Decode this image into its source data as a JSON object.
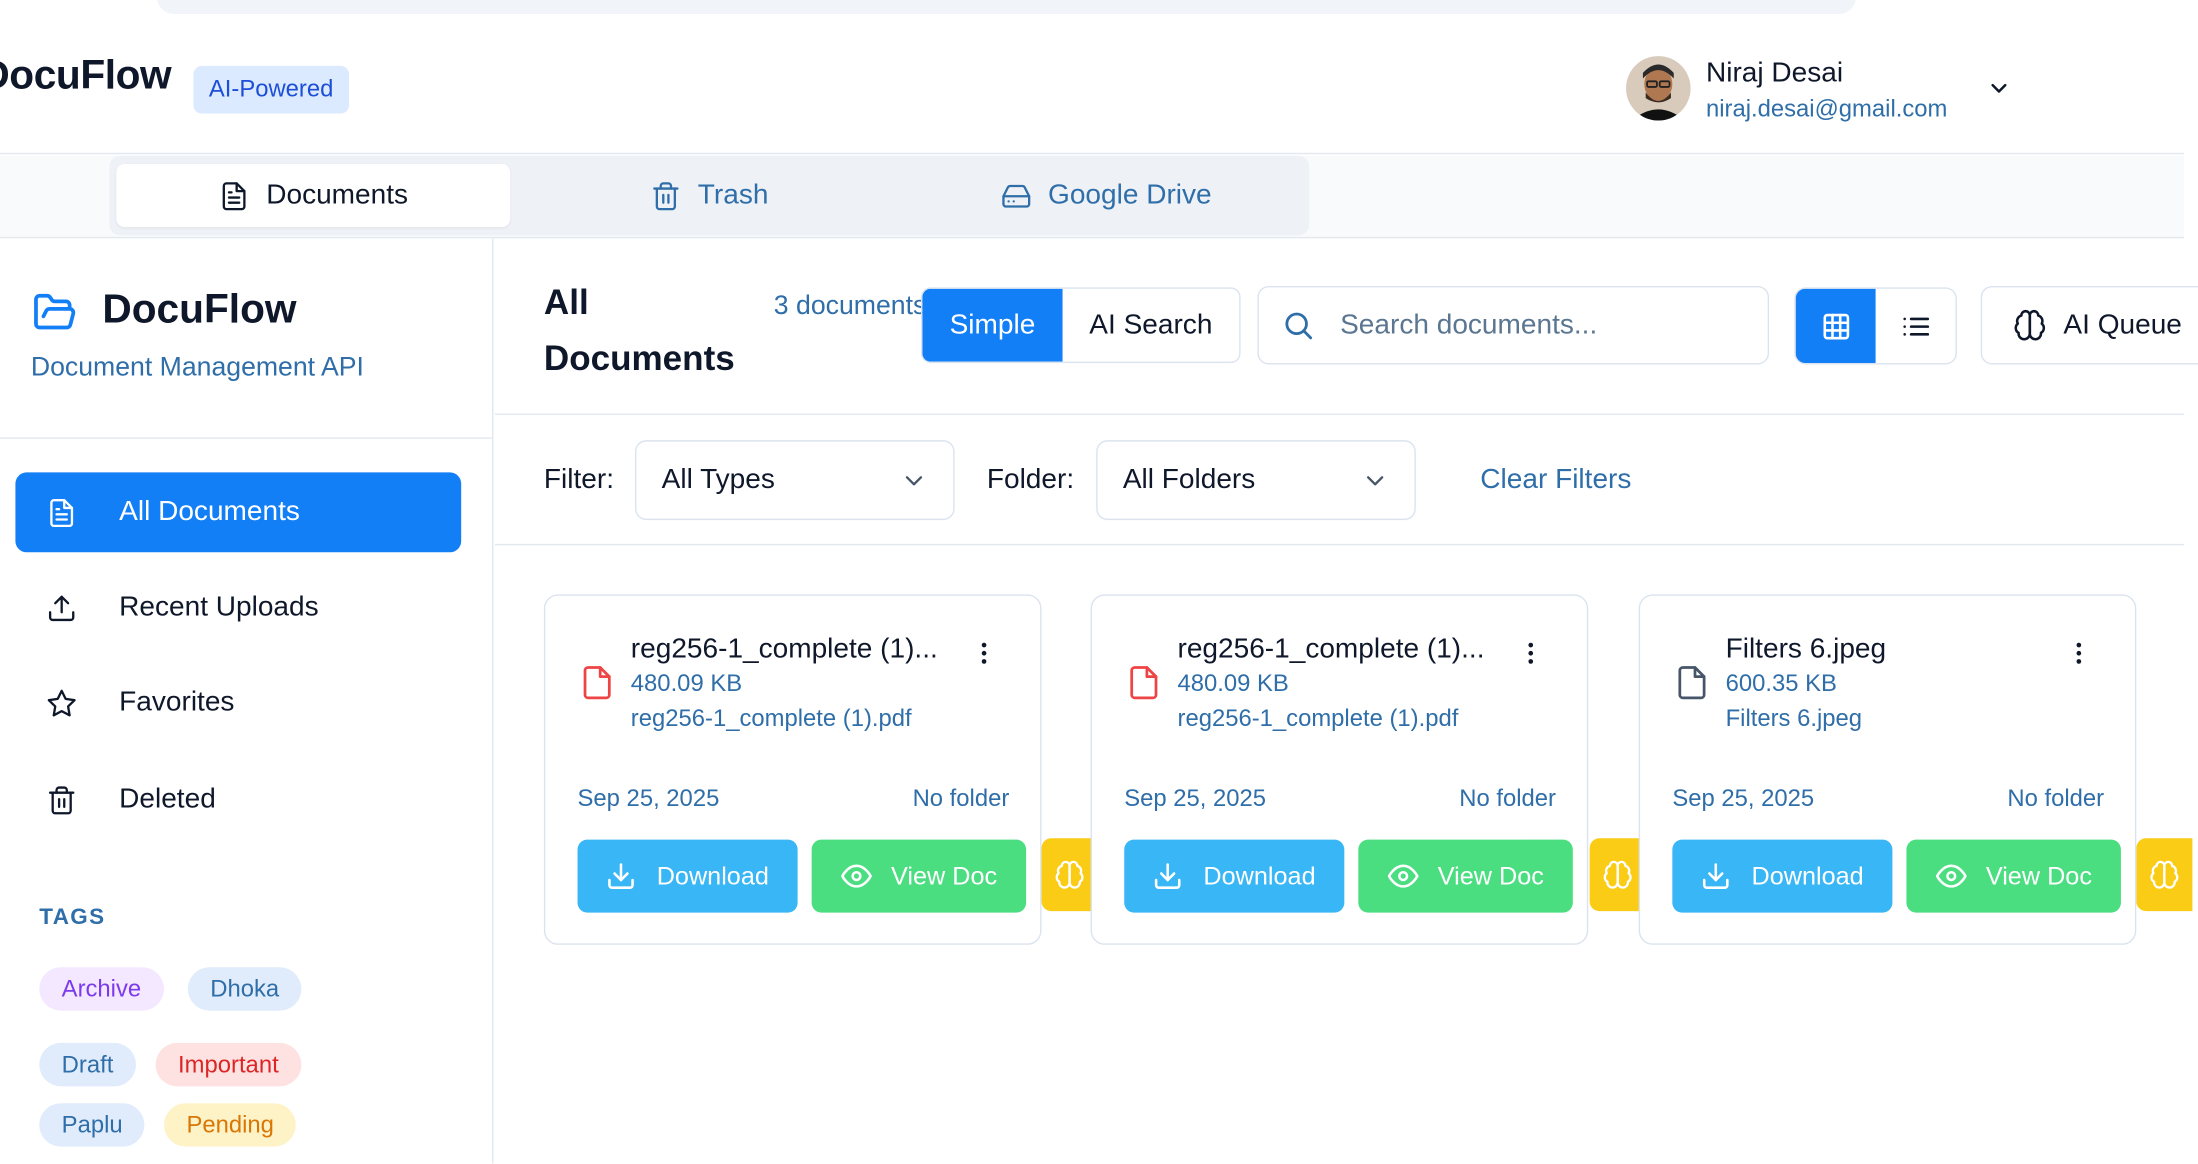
{
  "header": {
    "brand": "DocuFlow",
    "badge": "AI-Powered",
    "user": {
      "name": "Niraj Desai",
      "email": "niraj.desai@gmail.com"
    }
  },
  "tabs": [
    {
      "label": "Documents",
      "icon": "document-icon",
      "active": true
    },
    {
      "label": "Trash",
      "icon": "trash-icon",
      "active": false
    },
    {
      "label": "Google Drive",
      "icon": "drive-icon",
      "active": false
    }
  ],
  "sidebar": {
    "title": "DocuFlow",
    "subtitle": "Document Management API",
    "items": [
      {
        "label": "All Documents",
        "icon": "document-icon",
        "active": true
      },
      {
        "label": "Recent Uploads",
        "icon": "upload-icon",
        "active": false
      },
      {
        "label": "Favorites",
        "icon": "star-icon",
        "active": false
      },
      {
        "label": "Deleted",
        "icon": "trash-icon",
        "active": false
      }
    ],
    "tags_heading": "TAGS",
    "tags": [
      {
        "label": "Archive",
        "color": "#7c3aed",
        "bg": "#f3e8ff"
      },
      {
        "label": "Dhoka",
        "color": "#2f6ea8",
        "bg": "#e0ecfb"
      },
      {
        "label": "Draft",
        "color": "#2f6ea8",
        "bg": "#e0ecfb"
      },
      {
        "label": "Important",
        "color": "#dc2626",
        "bg": "#fee2e2"
      },
      {
        "label": "Paplu",
        "color": "#2f6ea8",
        "bg": "#e0ecfb"
      },
      {
        "label": "Pending",
        "color": "#d97706",
        "bg": "#fef3c7"
      }
    ]
  },
  "main": {
    "title": "All Documents",
    "count": "3 documents",
    "search_modes": {
      "simple": "Simple",
      "ai": "AI Search"
    },
    "search_placeholder": "Search documents...",
    "ai_queue": "AI Queue",
    "filter_label": "Filter:",
    "filter_value": "All Types",
    "folder_label": "Folder:",
    "folder_value": "All Folders",
    "clear_filters": "Clear Filters"
  },
  "documents": [
    {
      "name": "reg256-1_complete (1)...",
      "size": "480.09 KB",
      "filename": "reg256-1_complete (1).pdf",
      "date": "Sep 25, 2025",
      "folder": "No folder",
      "type": "pdf",
      "download": "Download",
      "view": "View Doc"
    },
    {
      "name": "reg256-1_complete (1)...",
      "size": "480.09 KB",
      "filename": "reg256-1_complete (1).pdf",
      "date": "Sep 25, 2025",
      "folder": "No folder",
      "type": "pdf",
      "download": "Download",
      "view": "View Doc"
    },
    {
      "name": "Filters 6.jpeg",
      "size": "600.35 KB",
      "filename": "Filters 6.jpeg",
      "date": "Sep 25, 2025",
      "folder": "No folder",
      "type": "image",
      "download": "Download",
      "view": "View Doc"
    }
  ],
  "colors": {
    "accent": "#137ff7",
    "download": "#38b6f5",
    "view": "#4ade80",
    "ai": "#facc15",
    "muted": "#2f6ea8"
  }
}
